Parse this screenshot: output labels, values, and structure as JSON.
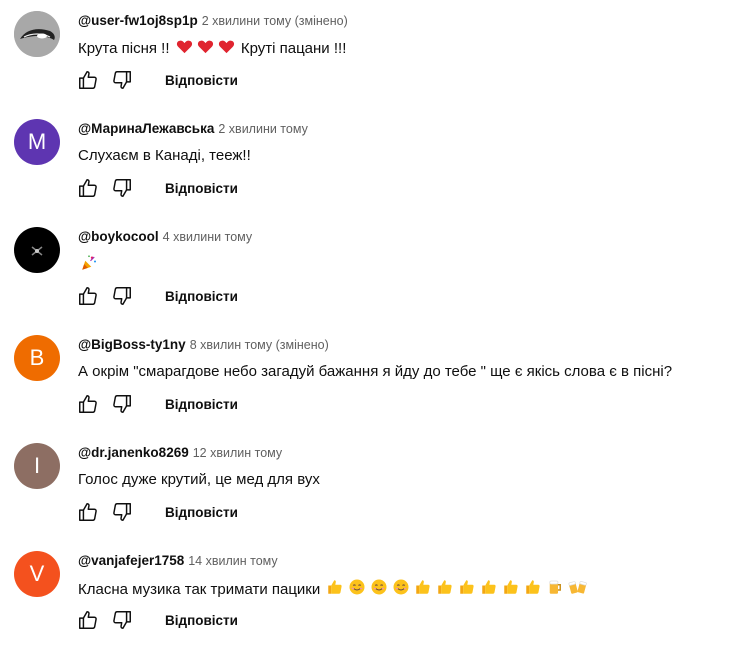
{
  "reply_label": "Відповісти",
  "comments": [
    {
      "avatar": {
        "kind": "image",
        "name": "user-avatar-icon",
        "bg": "#b9b9b9"
      },
      "author": "@user-fw1oj8sp1p",
      "time": "2 хвилини тому (змінено)",
      "text": "Крута пісня !!",
      "emoji_after": [
        "heart",
        "heart",
        "heart"
      ],
      "text_after": "Круті пацани !!!"
    },
    {
      "avatar": {
        "kind": "letter",
        "letter": "M",
        "bg": "#5e35b1"
      },
      "author": "@МаринаЛежавська",
      "time": "2 хвилини тому",
      "text": "Слухаєм в Канаді, тееж!!"
    },
    {
      "avatar": {
        "kind": "image",
        "name": "user-avatar-icon",
        "bg": "#000000"
      },
      "author": "@boykocool",
      "time": "4 хвилини тому",
      "text": "",
      "emoji_after": [
        "party-popper"
      ]
    },
    {
      "avatar": {
        "kind": "letter",
        "letter": "B",
        "bg": "#ef6c00"
      },
      "author": "@BigBoss-ty1ny",
      "time": "8 хвилин тому (змінено)",
      "text": "А окрім \"смарагдове небо загадуй бажання я йду до тебе \" ще є якісь слова є в пісні?"
    },
    {
      "avatar": {
        "kind": "letter",
        "letter": "I",
        "bg": "#8d6e63"
      },
      "author": "@dr.janenko8269",
      "time": "12 хвилин тому",
      "text": "Голос дуже крутий, це мед для вух"
    },
    {
      "avatar": {
        "kind": "letter",
        "letter": "V",
        "bg": "#f4511e"
      },
      "author": "@vanjafejer1758",
      "time": "14 хвилин тому",
      "text": "Класна музика так тримати пацики",
      "emoji_after": [
        "thumbs-up",
        "smile",
        "smile",
        "smile",
        "thumbs-up",
        "thumbs-up",
        "thumbs-up",
        "thumbs-up",
        "thumbs-up",
        "thumbs-up",
        "beer",
        "clinking-beers"
      ]
    }
  ]
}
